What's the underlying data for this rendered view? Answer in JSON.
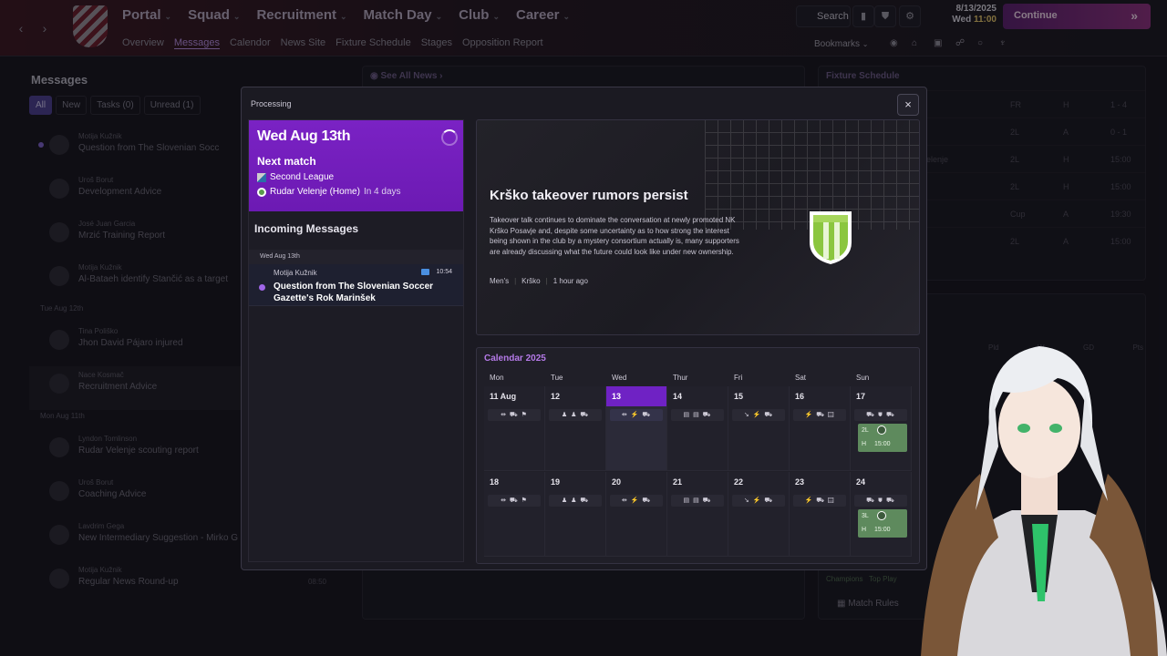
{
  "topbar": {
    "nav_back": "‹",
    "nav_forward": "›",
    "main_nav": [
      {
        "label": "Portal"
      },
      {
        "label": "Squad"
      },
      {
        "label": "Recruitment"
      },
      {
        "label": "Match Day"
      },
      {
        "label": "Club"
      },
      {
        "label": "Career"
      }
    ],
    "sub_nav": [
      "Overview",
      "Messages",
      "Calendor",
      "News Site",
      "Fixture Schedule",
      "Stages",
      "Opposition Report"
    ],
    "active_sub": "Messages",
    "search_label": "Search",
    "date": "8/13/2025",
    "day": "Wed",
    "time": "11:00",
    "continue_label": "Continue",
    "bookmarks_label": "Bookmarks"
  },
  "messages_panel": {
    "title": "Messages",
    "filters": [
      "All",
      "New",
      "Tasks (0)",
      "Unread (1)"
    ],
    "items": [
      {
        "from": "Motija Kužnik",
        "subject": "Question from The Slovenian Socc"
      },
      {
        "from": "Uroš Borut",
        "subject": "Development Advice"
      },
      {
        "from": "José Juan Garcia",
        "subject": "Mrzić Training Report"
      },
      {
        "from": "Motija Kužnik",
        "subject": "Al-Bataeh identify Stančić as a target"
      },
      {
        "sep": "Tue Aug 12th"
      },
      {
        "from": "Tina Poliško",
        "subject": "Jhon David Pájaro injured"
      },
      {
        "from": "Nace Kosmač",
        "subject": "Recruitment Advice"
      },
      {
        "sep": "Mon Aug 11th"
      },
      {
        "from": "Lyndon Tomlinson",
        "subject": "Rudar Velenje scouting report"
      },
      {
        "from": "Uroš Borut",
        "subject": "Coaching Advice"
      },
      {
        "from": "Lavdrim Gega",
        "subject": "New Intermediary Suggestion - Mirko G"
      },
      {
        "from": "Motija Kužnik",
        "subject": "Regular News Round-up",
        "time": "08:50"
      }
    ]
  },
  "bg_news": {
    "link": "See All News"
  },
  "bg_fixtures": {
    "title": "Fixture Schedule",
    "rows": [
      {
        "comp": "FR",
        "venue": "H",
        "res": "1 - 4"
      },
      {
        "comp": "2L",
        "venue": "A",
        "res": "0 - 1"
      },
      {
        "comp": "2L",
        "venue": "H",
        "res": "15:00",
        "team": "elenje"
      },
      {
        "comp": "2L",
        "venue": "H",
        "res": "15:00"
      },
      {
        "comp": "Cup",
        "venue": "A",
        "res": "19:30"
      },
      {
        "comp": "2L",
        "venue": "A",
        "res": "15:00"
      }
    ],
    "footer_links": [
      "Champions",
      "Top Play"
    ],
    "match_rules": "Match Rules",
    "table_headers": [
      "Pld",
      "W",
      "GD",
      "Pts"
    ]
  },
  "modal": {
    "title": "Processing",
    "close": "×",
    "processing": {
      "date": "Wed Aug 13th",
      "next_match_label": "Next match",
      "competition": "Second League",
      "opponent": "Rudar Velenje (Home)",
      "countdown": "In 4 days",
      "incoming_title": "Incoming Messages",
      "incoming_date": "Wed Aug 13th",
      "message": {
        "from": "Motija Kužnik",
        "time": "10:54",
        "subject": "Question from The Slovenian Soccer Gazette's Rok Marinšek"
      }
    },
    "news": {
      "headline": "Krško takeover rumors persist",
      "body": "Takeover talk continues to dominate the conversation at newly promoted NK Krško Posavje and, despite some uncertainty as to how strong the interest being shown in the club by a mystery consortium actually is, many supporters are already discussing what the future could look like under new ownership.",
      "tags": [
        "Men's",
        "Krško",
        "1 hour ago"
      ],
      "crest_colors": [
        "#8bc63f",
        "#ffffff"
      ]
    },
    "calendar": {
      "title": "Calendar 2025",
      "weekdays": [
        "Mon",
        "Tue",
        "Wed",
        "Thur",
        "Fri",
        "Sat",
        "Sun"
      ],
      "weeks": [
        [
          {
            "day": "11 Aug",
            "icons": "⇹ ⛟ ⚑"
          },
          {
            "day": "12",
            "icons": "♟ ♟ ⛟"
          },
          {
            "day": "13",
            "icons": "⇹ ⚡ ⛟",
            "today": true
          },
          {
            "day": "14",
            "icons": "▤ ▤ ⛟"
          },
          {
            "day": "15",
            "icons": "↘ ⚡ ⛟"
          },
          {
            "day": "16",
            "icons": "⚡ ⛟ ▤"
          },
          {
            "day": "17",
            "icons": "⛟ ⛊ ⛟",
            "match": {
              "comp": "2L",
              "venue": "H",
              "time": "15:00"
            }
          }
        ],
        [
          {
            "day": "18",
            "icons": "⇹ ⛟ ⚑"
          },
          {
            "day": "19",
            "icons": "♟ ♟ ⛟"
          },
          {
            "day": "20",
            "icons": "⇹ ⚡ ⛟"
          },
          {
            "day": "21",
            "icons": "▤ ▤ ⛟"
          },
          {
            "day": "22",
            "icons": "↘ ⚡ ⛟"
          },
          {
            "day": "23",
            "icons": "⚡ ⛟ ▤"
          },
          {
            "day": "24",
            "icons": "⛟ ⛊ ⛟",
            "match": {
              "comp": "3L",
              "venue": "H",
              "time": "15:00"
            }
          }
        ]
      ]
    }
  },
  "colors": {
    "accent": "#6f22c4",
    "continue": "#8c2f7e",
    "match": "#5e8a5d"
  }
}
